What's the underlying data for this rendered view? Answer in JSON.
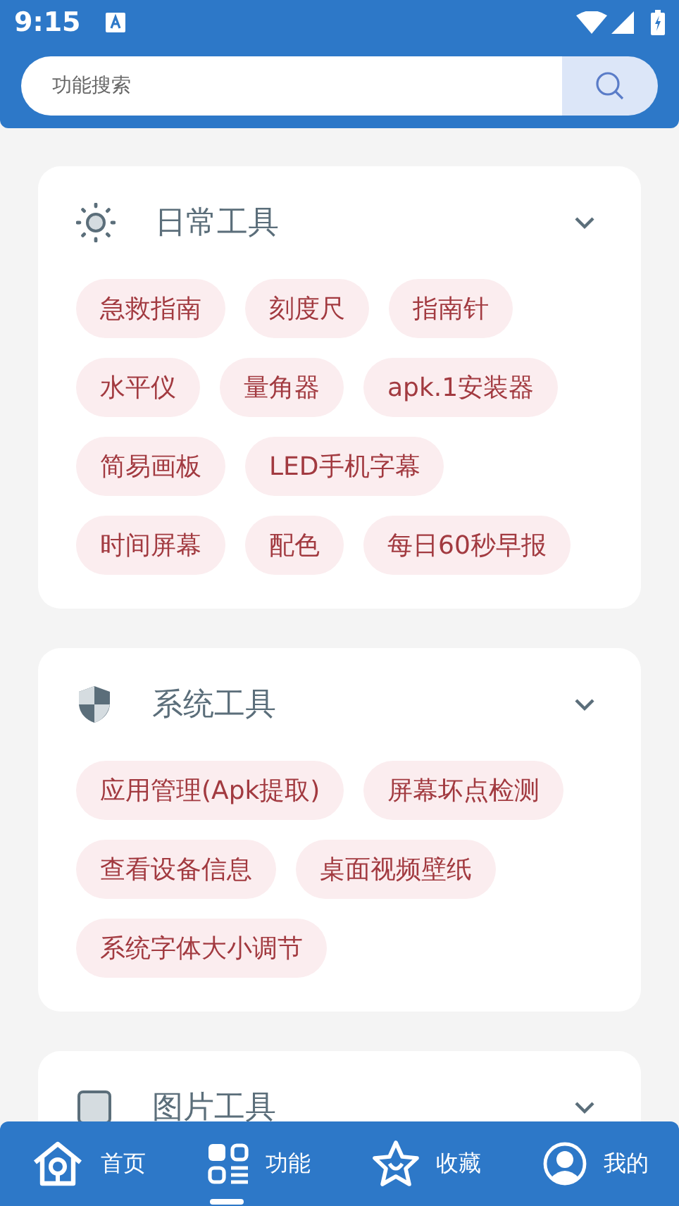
{
  "status_bar": {
    "time": "9:15"
  },
  "search": {
    "placeholder": "功能搜索"
  },
  "sections": [
    {
      "kind": "sun",
      "title": "日常工具",
      "items": [
        "急救指南",
        "刻度尺",
        "指南针",
        "水平仪",
        "量角器",
        "apk.1安装器",
        "简易画板",
        "LED手机字幕",
        "时间屏幕",
        "配色",
        "每日60秒早报"
      ]
    },
    {
      "kind": "shield",
      "title": "系统工具",
      "items": [
        "应用管理(Apk提取)",
        "屏幕坏点检测",
        "查看设备信息",
        "桌面视频壁纸",
        "系统字体大小调节"
      ]
    },
    {
      "kind": "image",
      "title": "图片工具"
    }
  ],
  "bottom_nav": [
    {
      "kind": "home",
      "label": "首页",
      "selected": false
    },
    {
      "kind": "grid",
      "label": "功能",
      "selected": true
    },
    {
      "kind": "star",
      "label": "收藏",
      "selected": false
    },
    {
      "kind": "user",
      "label": "我的",
      "selected": false
    }
  ]
}
